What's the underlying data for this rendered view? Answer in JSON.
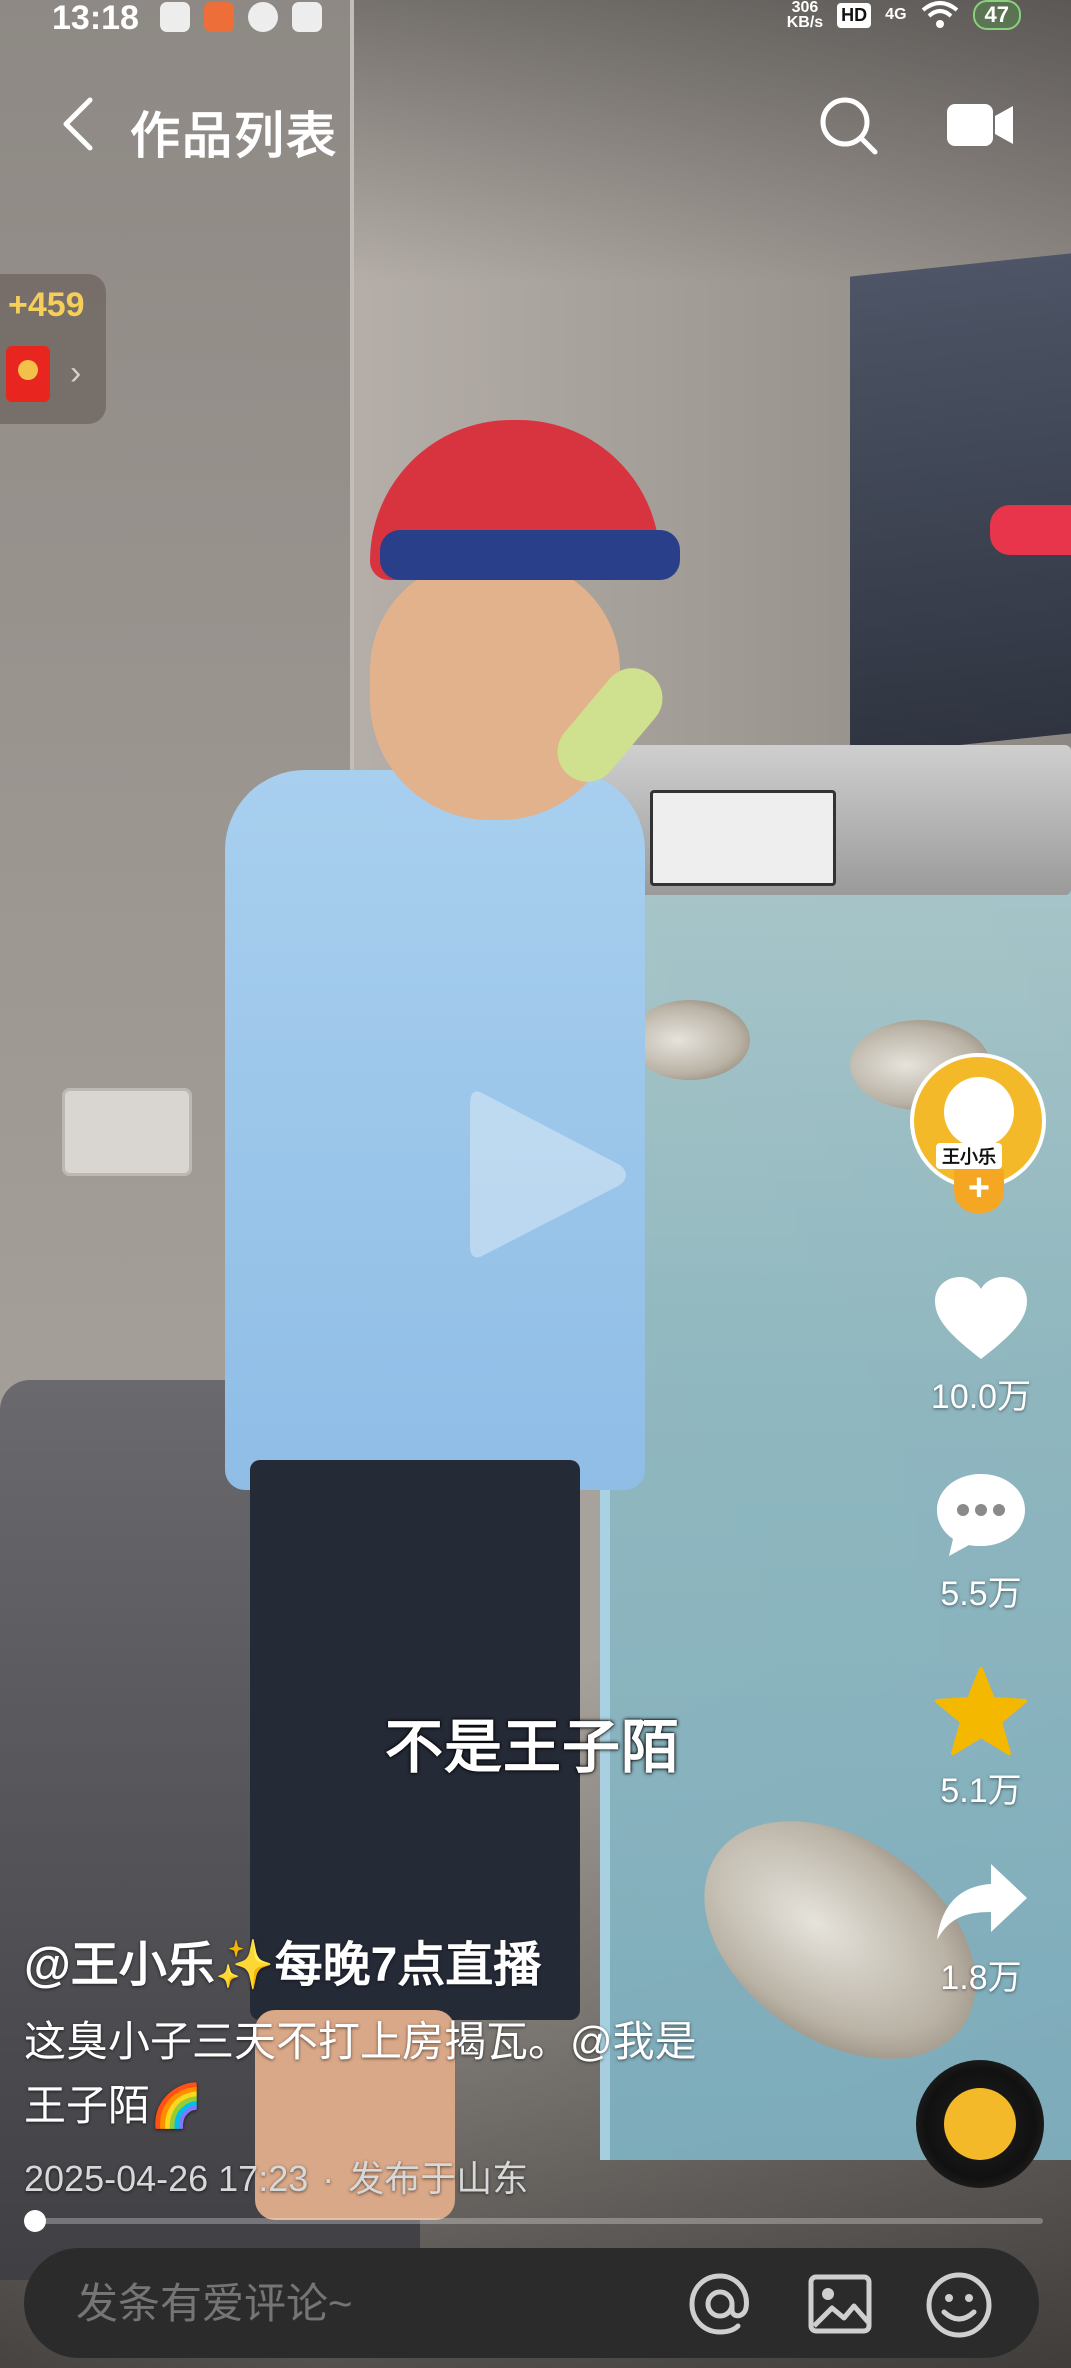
{
  "status_bar": {
    "time": "13:18",
    "net_speed_value": "306",
    "net_speed_unit": "KB/s",
    "hd": "HD",
    "signal": "4G",
    "battery": "47"
  },
  "nav": {
    "title": "作品列表",
    "icons": [
      "back-icon",
      "search-icon",
      "camera-icon"
    ]
  },
  "reward": {
    "count": "+459",
    "arrow": "›"
  },
  "video": {
    "subtitle": "不是王子陌",
    "is_paused": true
  },
  "actions": {
    "like_count": "10.0万",
    "comment_count": "5.5万",
    "favorite_count": "5.1万",
    "share_count": "1.8万",
    "follow_symbol": "+",
    "avatar_label": "王小乐"
  },
  "post": {
    "author": "@王小乐✨每晚7点直播",
    "description_line1": "这臭小子三天不打上房揭瓦。@我是",
    "description_line2": "王子陌🌈",
    "date": "2025-04-26 17:23",
    "separator": "·",
    "location": "发布于山东"
  },
  "progress": {
    "fraction": 0.01
  },
  "comment_bar": {
    "placeholder": "发条有爱评论~"
  },
  "colors": {
    "accent_gold": "#f6cf5a",
    "avatar_yellow": "#f3b928",
    "favorite_yellow": "#f5b800",
    "red_packet": "#e8251e"
  }
}
